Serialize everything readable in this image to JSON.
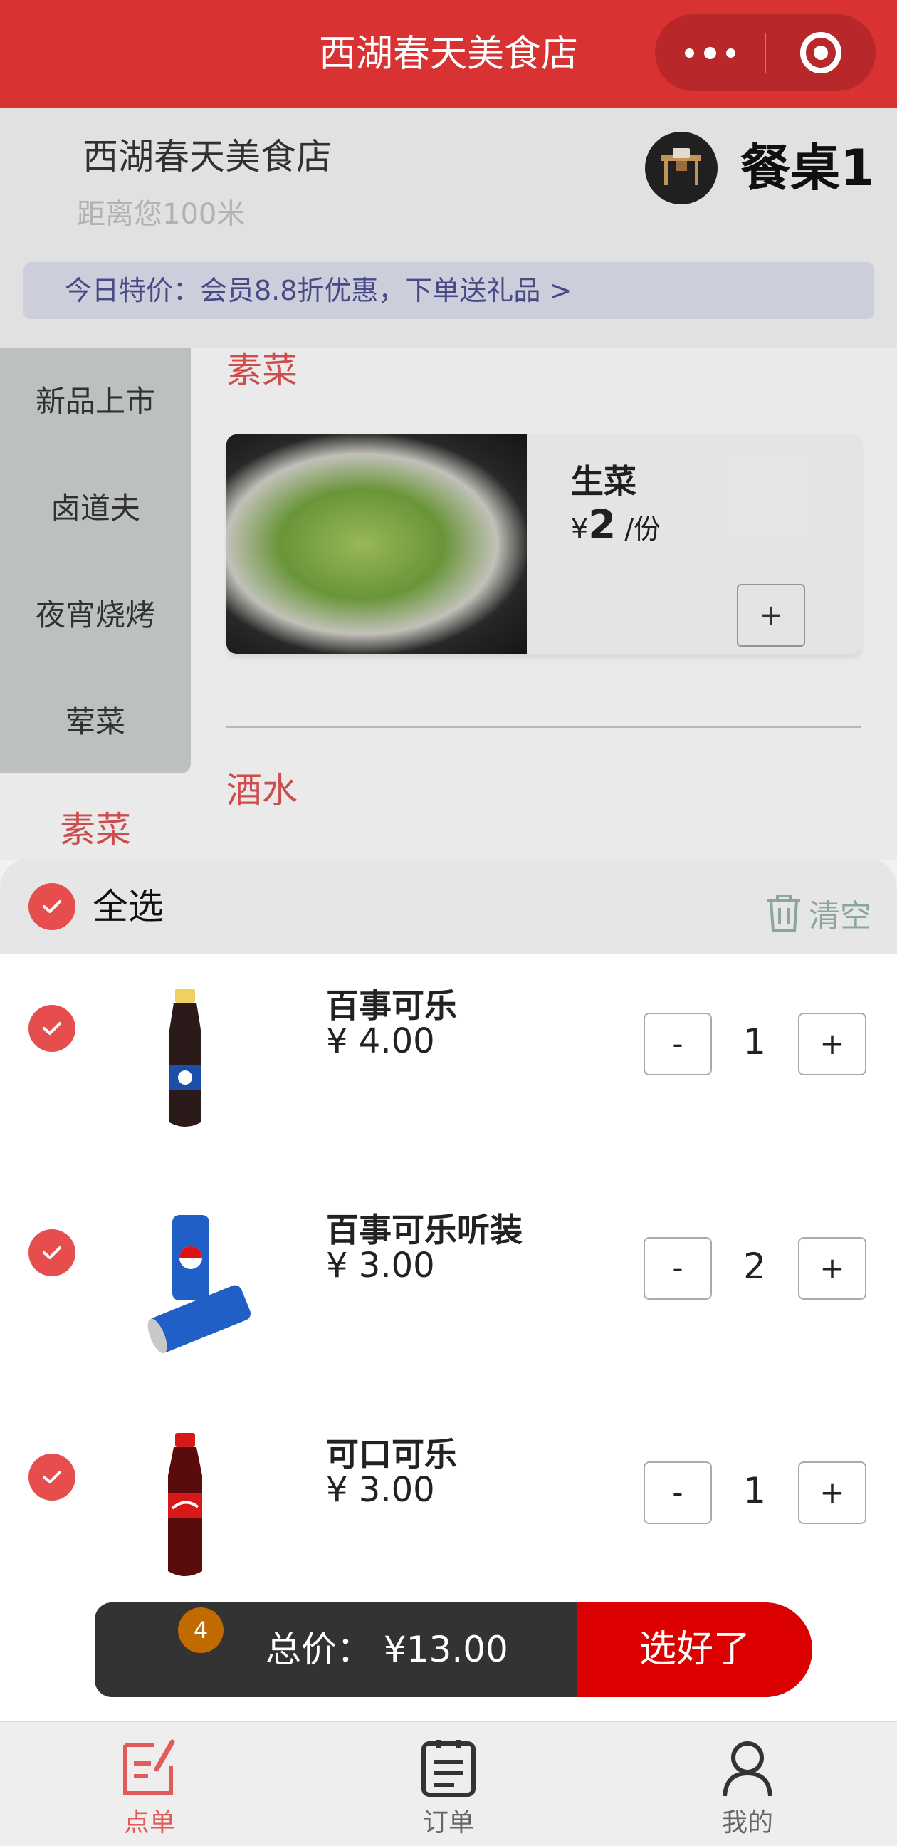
{
  "nav": {
    "title": "西湖春天美食店"
  },
  "store": {
    "name": "西湖春天美食店",
    "distance": "距离您100米",
    "table": "餐桌1"
  },
  "promo": {
    "text": "今日特价：会员8.8折优惠，下单送礼品 >"
  },
  "categories": {
    "items": [
      "新品上市",
      "卤道夫",
      "夜宵烧烤",
      "荤菜"
    ],
    "active": "素菜"
  },
  "menu": {
    "section_veg": "素菜",
    "section_drinks": "酒水",
    "dish": {
      "name": "生菜",
      "currency": "¥",
      "price": "2",
      "unit": "/份",
      "add_label": "+"
    }
  },
  "cart": {
    "select_all_label": "全选",
    "clear_label": "清空",
    "minus_label": "-",
    "plus_label": "+",
    "items": [
      {
        "name": "百事可乐",
        "price": "¥ 4.00",
        "qty": "1"
      },
      {
        "name": "百事可乐听装",
        "price": "¥ 3.00",
        "qty": "2"
      },
      {
        "name": "可口可乐",
        "price": "¥ 3.00",
        "qty": "1"
      }
    ],
    "total_label": "总价：",
    "total_value": "¥13.00",
    "count_badge": "4",
    "confirm_label": "选好了"
  },
  "tabbar": {
    "items": [
      {
        "label": "点单",
        "icon": "order-edit-icon",
        "active": true
      },
      {
        "label": "订单",
        "icon": "order-list-icon",
        "active": false
      },
      {
        "label": "我的",
        "icon": "user-icon",
        "active": false
      }
    ]
  },
  "colors": {
    "primary_red": "#d93233",
    "check_red": "#e64d4d",
    "confirm_red": "#dd0000",
    "badge_orange": "#c06a00",
    "promo_text": "#4a4d8a"
  }
}
